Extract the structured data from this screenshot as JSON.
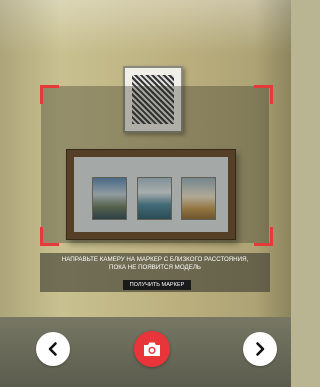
{
  "overlay": {
    "instruction_line1": "НАПРАВЬТЕ КАМЕРУ НА МАРКЕР С БЛИЗКОГО РАССТОЯНИЯ,",
    "instruction_line2": "ПОКА НЕ ПОЯВИТСЯ МОДЕЛЬ",
    "get_marker_label": "ПОЛУЧИТЬ МАРКЕР"
  },
  "controls": {
    "back_icon": "chevron-left-icon",
    "next_icon": "chevron-right-icon",
    "capture_icon": "camera-icon"
  },
  "colors": {
    "accent": "#e8353a",
    "frame_corner": "#e53a3a"
  }
}
